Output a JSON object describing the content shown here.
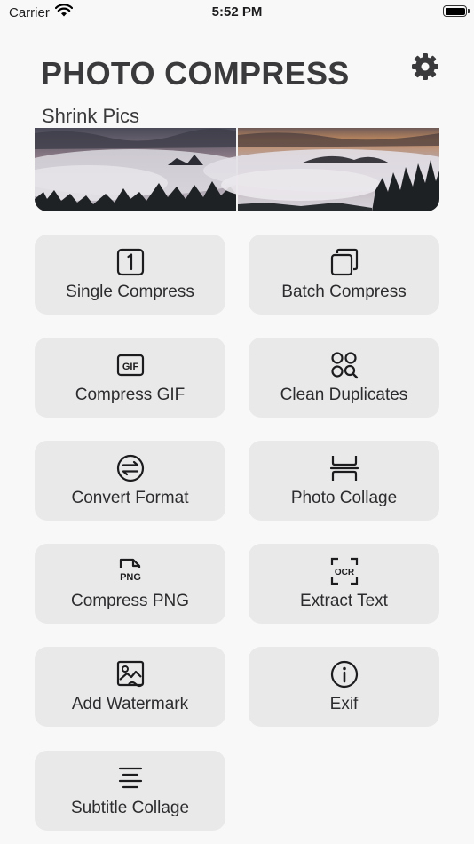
{
  "status_bar": {
    "carrier": "Carrier",
    "time": "5:52 PM",
    "battery_level": 1.0
  },
  "header": {
    "title": "PHOTO COMPRESS",
    "subtitle": "Shrink Pics",
    "settings_icon": "gear-icon"
  },
  "tiles": [
    {
      "label": "Single Compress",
      "icon": "single-square-icon"
    },
    {
      "label": "Batch Compress",
      "icon": "stacked-squares-icon"
    },
    {
      "label": "Compress GIF",
      "icon": "gif-icon"
    },
    {
      "label": "Clean Duplicates",
      "icon": "grid-search-icon"
    },
    {
      "label": "Convert Format",
      "icon": "swap-arrows-icon"
    },
    {
      "label": "Photo Collage",
      "icon": "collage-icon"
    },
    {
      "label": "Compress PNG",
      "icon": "png-file-icon"
    },
    {
      "label": "Extract Text",
      "icon": "ocr-icon"
    },
    {
      "label": "Add Watermark",
      "icon": "image-watermark-icon"
    },
    {
      "label": "Exif",
      "icon": "info-icon"
    },
    {
      "label": "Subtitle Collage",
      "icon": "lines-icon"
    }
  ]
}
